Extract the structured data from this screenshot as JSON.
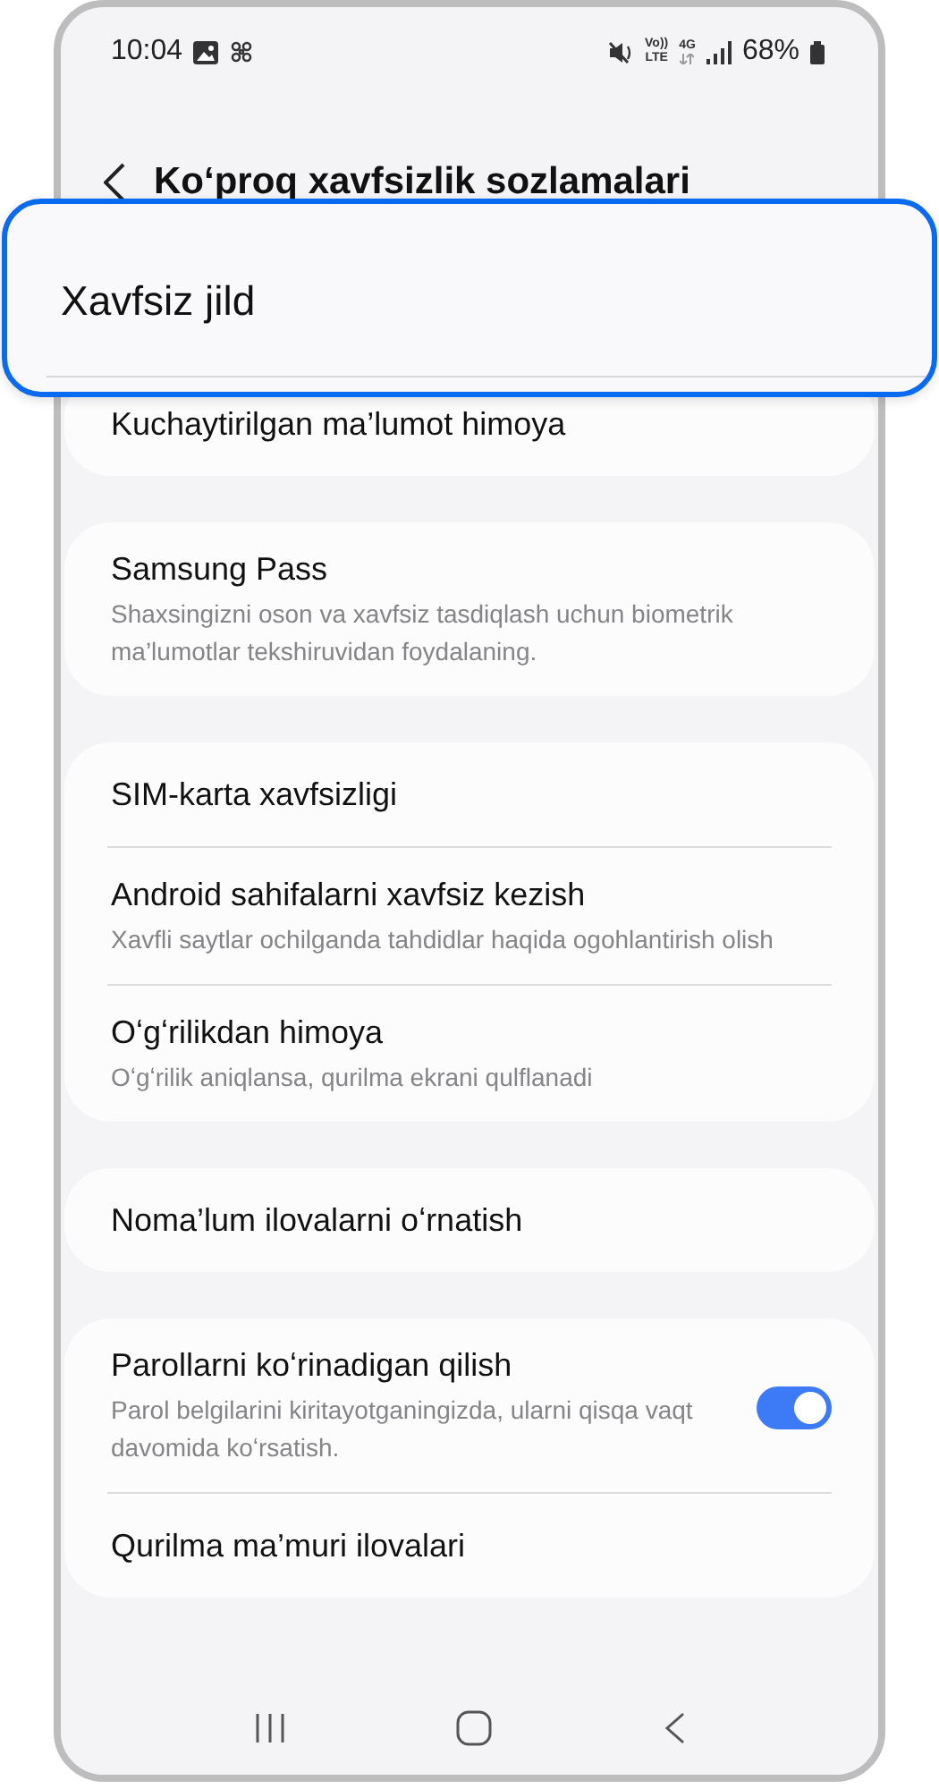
{
  "status_bar": {
    "time": "10:04",
    "volte_top": "Vo))",
    "volte_bottom": "LTE",
    "network": "4G",
    "battery": "68%"
  },
  "header": {
    "title": "Koʻproq xavfsizlik sozlamalari"
  },
  "highlight": {
    "title": "Xavfsiz jild"
  },
  "groups": [
    {
      "items": [
        {
          "kind": "link",
          "title": "Kuchaytirilgan ma’lumot himoya"
        }
      ]
    },
    {
      "items": [
        {
          "kind": "link",
          "title": "Samsung Pass",
          "subtitle": "Shaxsingizni oson va xavfsiz tasdiqlash uchun biometrik ma’lumotlar tekshiruvidan foydalaning."
        }
      ]
    },
    {
      "items": [
        {
          "kind": "link",
          "title": "SIM-karta xavfsizligi"
        },
        {
          "kind": "link",
          "title": "Android sahifalarni xavfsiz kezish",
          "subtitle": "Xavfli saytlar ochilganda tahdidlar haqida ogohlantirish olish"
        },
        {
          "kind": "link",
          "title": "Oʻgʻrilikdan himoya",
          "subtitle": "Oʻgʻrilik aniqlansa, qurilma ekrani qulflanadi"
        }
      ]
    },
    {
      "items": [
        {
          "kind": "link",
          "title": "Noma’lum ilovalarni oʻrnatish"
        }
      ]
    },
    {
      "items": [
        {
          "kind": "toggle",
          "title": "Parollarni koʻrinadigan qilish",
          "subtitle": "Parol belgilarini kiritayotganingizda, ularni qisqa vaqt davomida koʻrsatish.",
          "on": true
        },
        {
          "kind": "link",
          "title": "Qurilma ma’muri ilovalari"
        }
      ]
    }
  ]
}
